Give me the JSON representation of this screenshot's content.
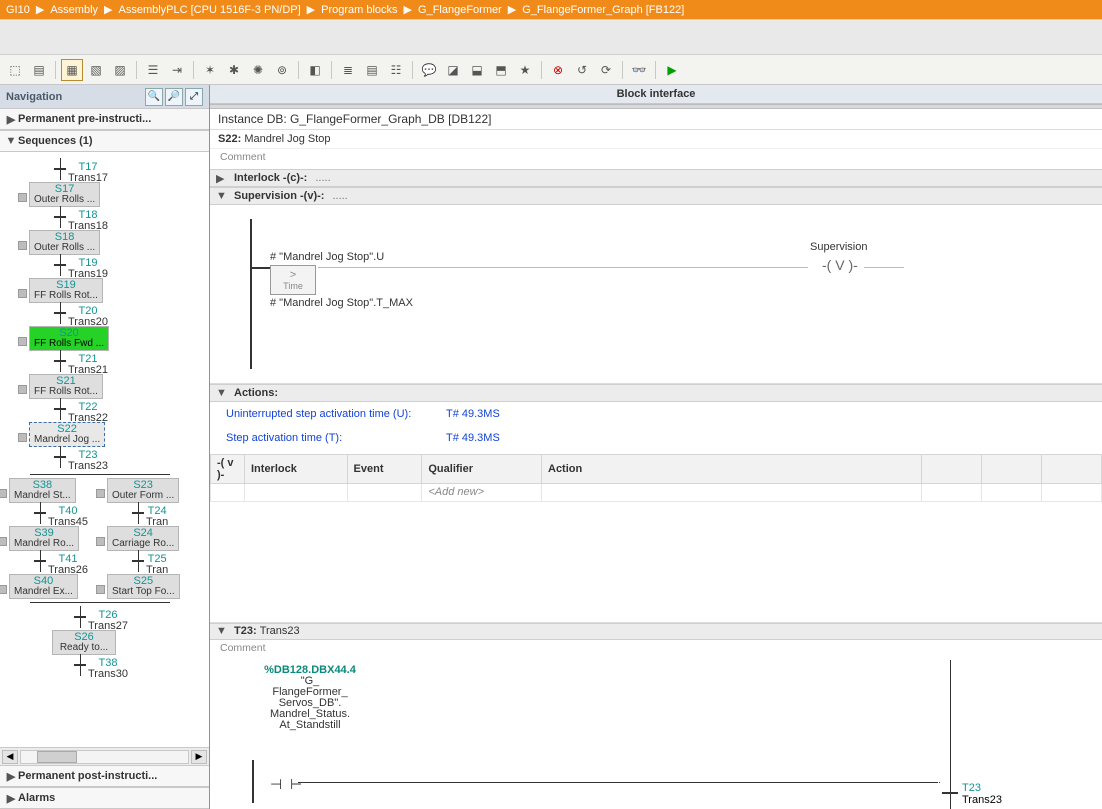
{
  "breadcrumb": [
    "GI10",
    "Assembly",
    "AssemblyPLC [CPU 1516F-3 PN/DP]",
    "Program blocks",
    "G_FlangeFormer",
    "G_FlangeFormer_Graph [FB122]"
  ],
  "blockInterface": "Block interface",
  "nav": {
    "title": "Navigation",
    "rows": {
      "pre": "Permanent pre-instructi...",
      "seq": "Sequences (1)",
      "post": "Permanent post-instructi...",
      "alarms": "Alarms"
    }
  },
  "steps": [
    {
      "t": "T17",
      "tn": "Trans17"
    },
    {
      "s": "S17",
      "sn": "Outer Rolls ..."
    },
    {
      "t": "T18",
      "tn": "Trans18"
    },
    {
      "s": "S18",
      "sn": "Outer Rolls ..."
    },
    {
      "t": "T19",
      "tn": "Trans19"
    },
    {
      "s": "S19",
      "sn": "FF Rolls Rot..."
    },
    {
      "t": "T20",
      "tn": "Trans20"
    },
    {
      "s": "S20",
      "sn": "FF Rolls Fwd ...",
      "active": true
    },
    {
      "t": "T21",
      "tn": "Trans21"
    },
    {
      "s": "S21",
      "sn": "FF Rolls Rot..."
    },
    {
      "t": "T22",
      "tn": "Trans22"
    },
    {
      "s": "S22",
      "sn": "Mandrel Jog ...",
      "sel": true
    },
    {
      "t": "T23",
      "tn": "Trans23"
    }
  ],
  "branchLeft": [
    {
      "s": "S38",
      "sn": "Mandrel St..."
    },
    {
      "t": "T40",
      "tn": "Trans45"
    },
    {
      "s": "S39",
      "sn": "Mandrel Ro..."
    },
    {
      "t": "T41",
      "tn": "Trans26"
    },
    {
      "s": "S40",
      "sn": "Mandrel Ex..."
    }
  ],
  "branchRight": [
    {
      "s": "S23",
      "sn": "Outer Form ..."
    },
    {
      "t": "T24",
      "tn": "Tran"
    },
    {
      "s": "S24",
      "sn": "Carriage Ro..."
    },
    {
      "t": "T25",
      "tn": "Tran"
    },
    {
      "s": "S25",
      "sn": "Start Top Fo..."
    }
  ],
  "tail": [
    {
      "t": "T26",
      "tn": "Trans27"
    },
    {
      "s": "S26",
      "sn": "Ready to..."
    },
    {
      "t": "T38",
      "tn": "Trans30"
    }
  ],
  "instance": "Instance DB: G_FlangeFormer_Graph_DB [DB122]",
  "stepHdr": {
    "id": "S22:",
    "name": "Mandrel Jog Stop"
  },
  "commentWord": "Comment",
  "interlock": "Interlock -(c)-:",
  "supervision": "Supervision -(v)-:",
  "supLabel": "Supervision",
  "cmp": {
    "top": "# \"Mandrel Jog Stop\".U",
    "op": ">",
    "sub": "Time",
    "bot": "# \"Mandrel Jog Stop\".T_MAX"
  },
  "coil": "-( V )-",
  "actions": {
    "title": "Actions:",
    "l1": {
      "label": "Uninterrupted step activation time (U):",
      "value": "T# 49.3MS"
    },
    "l2": {
      "label": "Step activation time (T):",
      "value": "T# 49.3MS"
    },
    "cols": [
      "Interlock",
      "Event",
      "Qualifier",
      "Action"
    ],
    "addnew": "<Add new>"
  },
  "trans": {
    "id": "T23:",
    "name": "Trans23",
    "tag": {
      "addr": "%DB128.DBX44.4",
      "lines": [
        "\"G_",
        "FlangeFormer_",
        "Servos_DB\".",
        "Mandrel_Status.",
        "At_Standstill"
      ]
    },
    "out": {
      "id": "T23",
      "name": "Trans23"
    }
  }
}
